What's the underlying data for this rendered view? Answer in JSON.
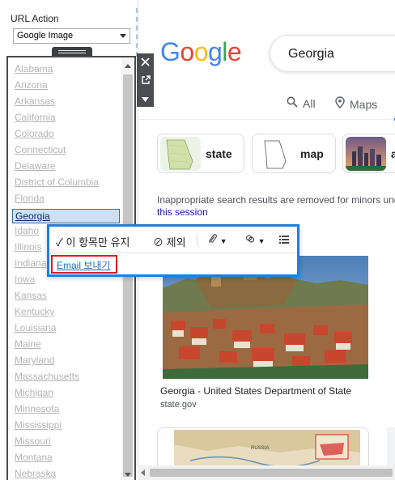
{
  "url_action": {
    "label": "URL Action",
    "selected": "Google Image"
  },
  "states": [
    "Alabama",
    "Arizona",
    "Arkansas",
    "California",
    "Colorado",
    "Connecticut",
    "Delaware",
    "District of Columbia",
    "Florida",
    "Georgia",
    "Idaho",
    "Illinois",
    "Indiana",
    "Iowa",
    "Kansas",
    "Kentucky",
    "Louisiana",
    "Maine",
    "Maryland",
    "Massachusetts",
    "Michigan",
    "Minnesota",
    "Mississippi",
    "Missouri",
    "Montana",
    "Nebraska"
  ],
  "selected_state": "Georgia",
  "side_tools": [
    "close-icon",
    "external-link-icon",
    "menu-arrow-icon"
  ],
  "google": {
    "logo": [
      "G",
      "o",
      "o",
      "g",
      "l",
      "e"
    ],
    "logo_colors": [
      "#4285F4",
      "#EA4335",
      "#FBBC05",
      "#4285F4",
      "#34A853",
      "#EA4335"
    ],
    "search_query": "Georgia",
    "tabs": [
      {
        "icon": "search-icon",
        "label": "All"
      },
      {
        "icon": "map-pin-icon",
        "label": "Maps"
      }
    ],
    "chips": [
      "state",
      "map",
      "a"
    ],
    "notice": "Inappropriate search results are removed for minors und",
    "notice_link": "this session",
    "result": {
      "title": "Georgia - United States Department of State",
      "source": "state.gov"
    },
    "map_label": "RUSSIA"
  },
  "popup": {
    "keep_only": "이 항목만 유지",
    "exclude": "제외",
    "send_email": "Email 보내기"
  },
  "colors": {
    "selection_blue": "#1e7fe0",
    "highlight_red": "#e01b1b",
    "accent_blue": "#1a73e8"
  }
}
